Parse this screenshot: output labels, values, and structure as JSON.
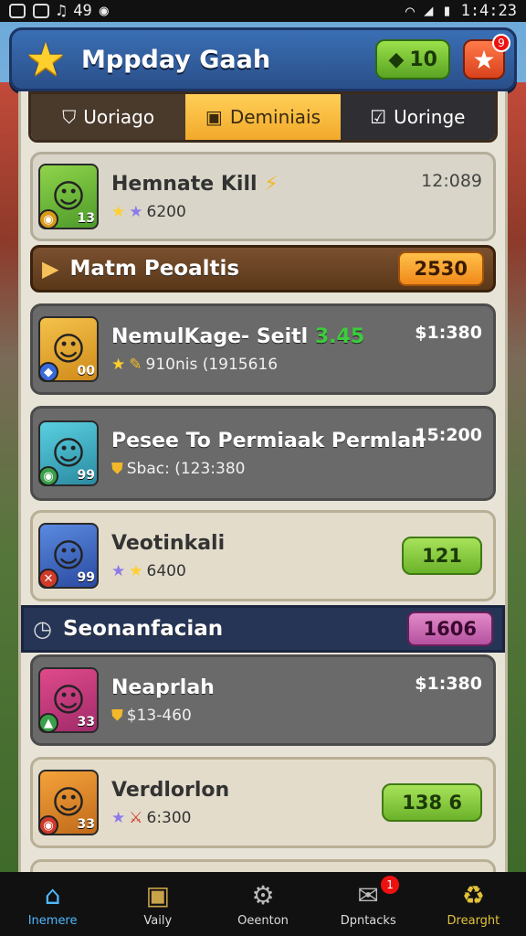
{
  "statusbar": {
    "left_text": "49",
    "time": "1:4:23"
  },
  "header": {
    "title": "Mppday Gaah",
    "coins": "10",
    "fav_badge": "9"
  },
  "tabs": [
    {
      "label": "Uoriago",
      "icon": "shield-icon"
    },
    {
      "label": "Deminiais",
      "icon": "box-icon"
    },
    {
      "label": "Uoringe",
      "icon": "check-icon"
    }
  ],
  "rows": [
    {
      "name": "Hemnate Kill",
      "sub": "6200",
      "price": "12:089",
      "level": "13"
    },
    {
      "name": "NemulKage- Seitl",
      "name_tag": "3.45",
      "sub": "910nis (1915616",
      "price": "$1:380",
      "level": "00"
    },
    {
      "name": "Pesee To Permiaak Permlan",
      "sub": "Sbac: (123:380",
      "price": "15:200",
      "level": "99"
    },
    {
      "name": "Veotinkali",
      "sub": "6400",
      "button": "121",
      "level": "99"
    },
    {
      "name": "Neaprlah",
      "sub": "$13-460",
      "price": "$1:380",
      "level": "33"
    },
    {
      "name": "Verdlorlon",
      "sub": "6:300",
      "button": "138 6",
      "level": "33"
    }
  ],
  "sections": [
    {
      "title": "Matm Peoaltis",
      "value": "2530"
    },
    {
      "title": "Seonanfacian",
      "value": "1606"
    }
  ],
  "nav": [
    {
      "label": "Inemere",
      "icon": "home-icon"
    },
    {
      "label": "Vaily",
      "icon": "box-icon"
    },
    {
      "label": "Oeenton",
      "icon": "gear-icon"
    },
    {
      "label": "Dpntacks",
      "icon": "chat-icon",
      "badge": "1"
    },
    {
      "label": "Drearght",
      "icon": "recycle-icon"
    }
  ],
  "colors": {
    "header_blue": "#2a4f8a",
    "active_tab": "#f2a92a",
    "section_brown": "#5a3818",
    "button_green": "#6bb22a",
    "nav_active": "#4fb8ff"
  }
}
